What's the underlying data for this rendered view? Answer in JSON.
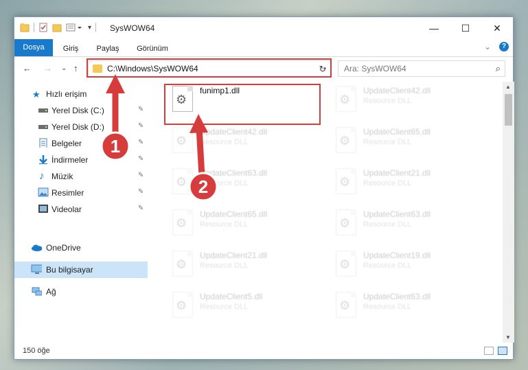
{
  "window": {
    "title": "SysWOW64",
    "minimize": "—",
    "maximize": "☐",
    "close": "✕"
  },
  "ribbon": {
    "tabs": [
      "Dosya",
      "Giriş",
      "Paylaş",
      "Görünüm"
    ],
    "expand": "⌄",
    "help": "?"
  },
  "nav": {
    "back": "←",
    "forward": "→",
    "recent": "⌄",
    "up": "↑",
    "address": "C:\\Windows\\SysWOW64",
    "address_dropdown": "⌄",
    "refresh": "↻",
    "search_placeholder": "Ara: SysWOW64",
    "search_icon": "⌕"
  },
  "sidebar": {
    "quick_access": "Hızlı erişim",
    "items": [
      {
        "label": "Yerel Disk (C:)",
        "icon": "drive-icon",
        "pinned": true
      },
      {
        "label": "Yerel Disk (D:)",
        "icon": "drive-icon",
        "pinned": true
      },
      {
        "label": "Belgeler",
        "icon": "documents-icon",
        "pinned": true
      },
      {
        "label": "İndirmeler",
        "icon": "downloads-icon",
        "pinned": true
      },
      {
        "label": "Müzik",
        "icon": "music-icon",
        "pinned": true
      },
      {
        "label": "Resimler",
        "icon": "pictures-icon",
        "pinned": true
      },
      {
        "label": "Videolar",
        "icon": "videos-icon",
        "pinned": true
      }
    ],
    "onedrive": "OneDrive",
    "this_pc": "Bu bilgisayar",
    "network": "Ağ",
    "pin_glyph": "📌"
  },
  "files": [
    {
      "name": "funimp1.dll",
      "type": "",
      "faded": false
    },
    {
      "name": "UpdateClient42.dll",
      "type": "Resource DLL",
      "faded": true
    },
    {
      "name": "UpdateClient42.dll",
      "type": "Resource DLL",
      "faded": true
    },
    {
      "name": "UpdateClient65.dll",
      "type": "Resource DLL",
      "faded": true
    },
    {
      "name": "UpdateClient63.dll",
      "type": "Resource DLL",
      "faded": true
    },
    {
      "name": "UpdateClient21.dll",
      "type": "Resource DLL",
      "faded": true
    },
    {
      "name": "UpdateClient65.dll",
      "type": "Resource DLL",
      "faded": true
    },
    {
      "name": "UpdateClient63.dll",
      "type": "Resource DLL",
      "faded": true
    },
    {
      "name": "UpdateClient21.dll",
      "type": "Resource DLL",
      "faded": true
    },
    {
      "name": "UpdateClient19.dll",
      "type": "Resource DLL",
      "faded": true
    },
    {
      "name": "UpdateClient5.dll",
      "type": "Resource DLL",
      "faded": true
    },
    {
      "name": "UpdateClient63.dll",
      "type": "Resource DLL",
      "faded": true
    }
  ],
  "status": {
    "count": "150 öğe"
  },
  "annotations": {
    "step1": "1",
    "step2": "2",
    "color": "#d63c3c"
  }
}
